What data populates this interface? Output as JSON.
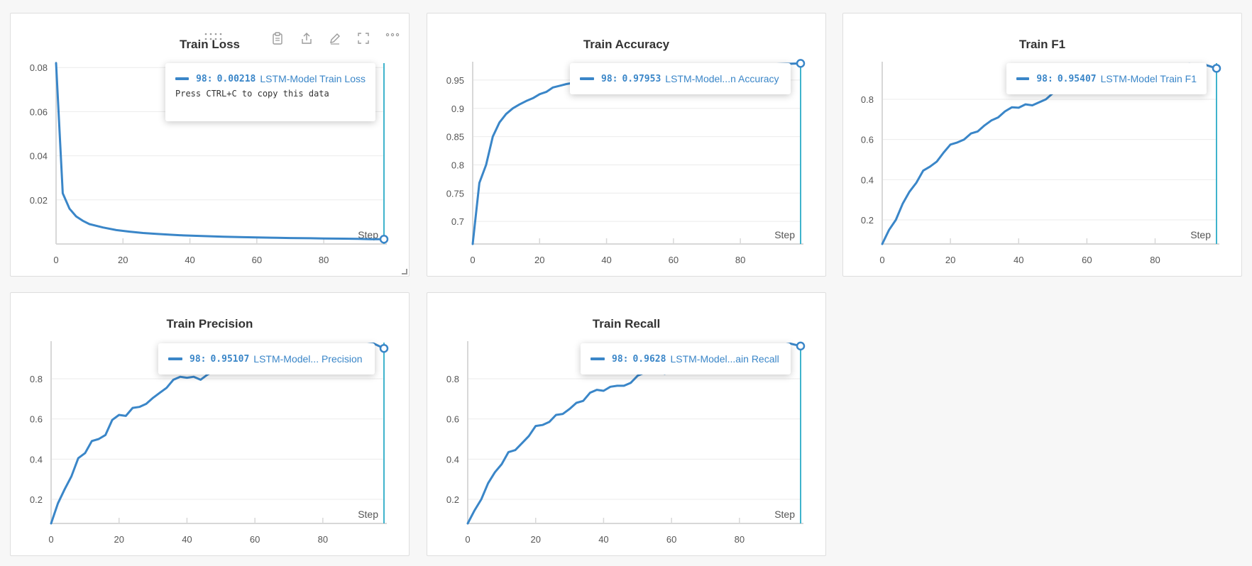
{
  "toolbar": {
    "icons": [
      "drag-handle-icon",
      "clipboard-icon",
      "share-icon",
      "edit-icon",
      "fullscreen-icon",
      "more-icon"
    ]
  },
  "colors": {
    "line": "#3a86c8",
    "cursor": "#3fb3cc",
    "grid": "#ebebeb",
    "axis": "#d8d8d8"
  },
  "chart_data": [
    {
      "type": "line",
      "title": "Train Loss",
      "xlabel": "Step",
      "xlim": [
        0,
        98
      ],
      "ylim": [
        0,
        0.082
      ],
      "xticks": [
        0,
        20,
        40,
        60,
        80
      ],
      "yticks": [
        0.02,
        0.04,
        0.06,
        0.08
      ],
      "ytick_labels": [
        "0.02",
        "0.04",
        "0.06",
        "0.08"
      ],
      "series": [
        {
          "name": "LSTM-Model Train Loss",
          "x": [
            0,
            2,
            4,
            6,
            8,
            10,
            14,
            18,
            22,
            26,
            30,
            34,
            38,
            42,
            46,
            50,
            56,
            60,
            66,
            70,
            76,
            80,
            86,
            90,
            94,
            98
          ],
          "y": [
            0.082,
            0.023,
            0.016,
            0.0125,
            0.0105,
            0.009,
            0.0075,
            0.0063,
            0.0056,
            0.005,
            0.0046,
            0.0042,
            0.0039,
            0.0037,
            0.0035,
            0.0033,
            0.0031,
            0.003,
            0.0028,
            0.0027,
            0.0026,
            0.0025,
            0.0024,
            0.0023,
            0.0022,
            0.00218
          ]
        }
      ],
      "tooltip": {
        "step": "98:",
        "value": "0.00218",
        "label": "LSTM-Model Train Loss",
        "hint": "Press CTRL+C to copy this data"
      }
    },
    {
      "type": "line",
      "title": "Train Accuracy",
      "xlabel": "Step",
      "xlim": [
        0,
        98
      ],
      "ylim": [
        0.66,
        0.98
      ],
      "xticks": [
        0,
        20,
        40,
        60,
        80
      ],
      "yticks": [
        0.7,
        0.75,
        0.8,
        0.85,
        0.9,
        0.95
      ],
      "ytick_labels": [
        "0.7",
        "0.75",
        "0.8",
        "0.85",
        "0.9",
        "0.95"
      ],
      "series": [
        {
          "name": "LSTM-Model Train Accuracy",
          "x": [
            0,
            2,
            4,
            6,
            8,
            10,
            12,
            14,
            16,
            18,
            20,
            22,
            24,
            26,
            28,
            30,
            32,
            34,
            36,
            40,
            50,
            60,
            70,
            80,
            90,
            98
          ],
          "y": [
            0.66,
            0.768,
            0.8,
            0.85,
            0.875,
            0.89,
            0.9,
            0.907,
            0.913,
            0.918,
            0.925,
            0.929,
            0.937,
            0.94,
            0.943,
            0.945,
            0.948,
            0.951,
            0.953,
            0.957,
            0.964,
            0.969,
            0.973,
            0.976,
            0.978,
            0.97953
          ]
        }
      ],
      "tooltip": {
        "step": "98:",
        "value": "0.97953",
        "label": "LSTM-Model...n Accuracy"
      }
    },
    {
      "type": "line",
      "title": "Train F1",
      "xlabel": "Step",
      "xlim": [
        0,
        98
      ],
      "ylim": [
        0.08,
        0.98
      ],
      "xticks": [
        0,
        20,
        40,
        60,
        80
      ],
      "yticks": [
        0.2,
        0.4,
        0.6,
        0.8
      ],
      "ytick_labels": [
        "0.2",
        "0.4",
        "0.6",
        "0.8"
      ],
      "series": [
        {
          "name": "LSTM-Model Train F1",
          "x": [
            0,
            2,
            4,
            6,
            8,
            10,
            12,
            14,
            16,
            18,
            20,
            22,
            24,
            26,
            28,
            30,
            32,
            34,
            36,
            38,
            40,
            42,
            44,
            46,
            48,
            50,
            54,
            60,
            70,
            80,
            90,
            95,
            98
          ],
          "y": [
            0.08,
            0.15,
            0.2,
            0.28,
            0.34,
            0.385,
            0.445,
            0.465,
            0.49,
            0.535,
            0.575,
            0.585,
            0.6,
            0.63,
            0.64,
            0.67,
            0.695,
            0.71,
            0.74,
            0.76,
            0.758,
            0.775,
            0.77,
            0.785,
            0.8,
            0.83,
            0.86,
            0.9,
            0.935,
            0.96,
            0.975,
            0.97,
            0.95407
          ]
        }
      ],
      "tooltip": {
        "step": "98:",
        "value": "0.95407",
        "label": "LSTM-Model Train F1"
      }
    },
    {
      "type": "line",
      "title": "Train Precision",
      "xlabel": "Step",
      "xlim": [
        0,
        98
      ],
      "ylim": [
        0.08,
        0.98
      ],
      "xticks": [
        0,
        20,
        40,
        60,
        80
      ],
      "yticks": [
        0.2,
        0.4,
        0.6,
        0.8
      ],
      "ytick_labels": [
        "0.2",
        "0.4",
        "0.6",
        "0.8"
      ],
      "series": [
        {
          "name": "LSTM-Model Train Precision",
          "x": [
            0,
            2,
            4,
            6,
            8,
            10,
            12,
            14,
            16,
            18,
            20,
            22,
            24,
            26,
            28,
            30,
            32,
            34,
            36,
            38,
            40,
            42,
            44,
            46,
            48,
            50,
            56,
            60,
            70,
            80,
            90,
            95,
            98
          ],
          "y": [
            0.08,
            0.18,
            0.25,
            0.315,
            0.405,
            0.43,
            0.49,
            0.5,
            0.52,
            0.595,
            0.62,
            0.615,
            0.655,
            0.66,
            0.675,
            0.705,
            0.73,
            0.755,
            0.795,
            0.81,
            0.805,
            0.81,
            0.795,
            0.82,
            0.84,
            0.85,
            0.87,
            0.89,
            0.92,
            0.945,
            0.965,
            0.975,
            0.95107
          ]
        }
      ],
      "tooltip": {
        "step": "98:",
        "value": "0.95107",
        "label": "LSTM-Model... Precision"
      }
    },
    {
      "type": "line",
      "title": "Train Recall",
      "xlabel": "Step",
      "xlim": [
        0,
        98
      ],
      "ylim": [
        0.08,
        0.98
      ],
      "xticks": [
        0,
        20,
        40,
        60,
        80
      ],
      "yticks": [
        0.2,
        0.4,
        0.6,
        0.8
      ],
      "ytick_labels": [
        "0.2",
        "0.4",
        "0.6",
        "0.8"
      ],
      "series": [
        {
          "name": "LSTM-Model Train Recall",
          "x": [
            0,
            2,
            4,
            6,
            8,
            10,
            12,
            14,
            16,
            18,
            20,
            22,
            24,
            26,
            28,
            30,
            32,
            34,
            36,
            38,
            40,
            42,
            44,
            46,
            48,
            50,
            54,
            58,
            60,
            70,
            80,
            90,
            95,
            98
          ],
          "y": [
            0.08,
            0.145,
            0.2,
            0.28,
            0.335,
            0.375,
            0.435,
            0.445,
            0.48,
            0.515,
            0.565,
            0.57,
            0.585,
            0.62,
            0.625,
            0.65,
            0.68,
            0.69,
            0.73,
            0.745,
            0.74,
            0.76,
            0.765,
            0.765,
            0.78,
            0.815,
            0.845,
            0.825,
            0.86,
            0.9,
            0.935,
            0.96,
            0.975,
            0.9628
          ]
        }
      ],
      "tooltip": {
        "step": "98:",
        "value": "0.9628",
        "label": "LSTM-Model...ain Recall"
      }
    }
  ]
}
